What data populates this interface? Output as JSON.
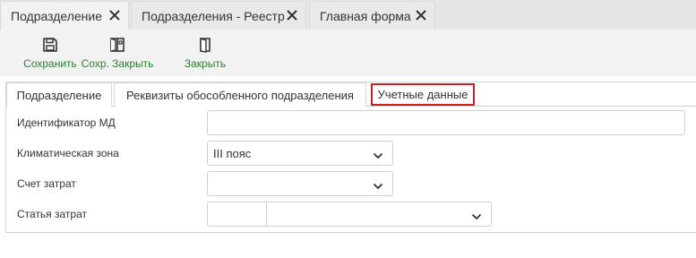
{
  "doc_tabs": [
    {
      "label": "Подразделение"
    },
    {
      "label": "Подразделения - Реестр"
    },
    {
      "label": "Главная форма"
    }
  ],
  "toolbar": {
    "save_label": "Сохранить",
    "save_close_label": "Сохр. Закрыть",
    "close_label": "Закрыть",
    "accent_color": "#2e7d32"
  },
  "form_tabs": [
    {
      "label": "Подразделение"
    },
    {
      "label": "Реквизиты обособленного подразделения"
    },
    {
      "label": "Учетные данные"
    }
  ],
  "form": {
    "md_id": {
      "label": "Идентификатор МД",
      "value": ""
    },
    "climate_zone": {
      "label": "Климатическая зона",
      "value": "III пояс"
    },
    "cost_account": {
      "label": "Счет затрат",
      "value": ""
    },
    "cost_item": {
      "label": "Статья затрат",
      "code": "",
      "value": ""
    }
  },
  "colors": {
    "active_tab_border": "#cc1f1f"
  }
}
